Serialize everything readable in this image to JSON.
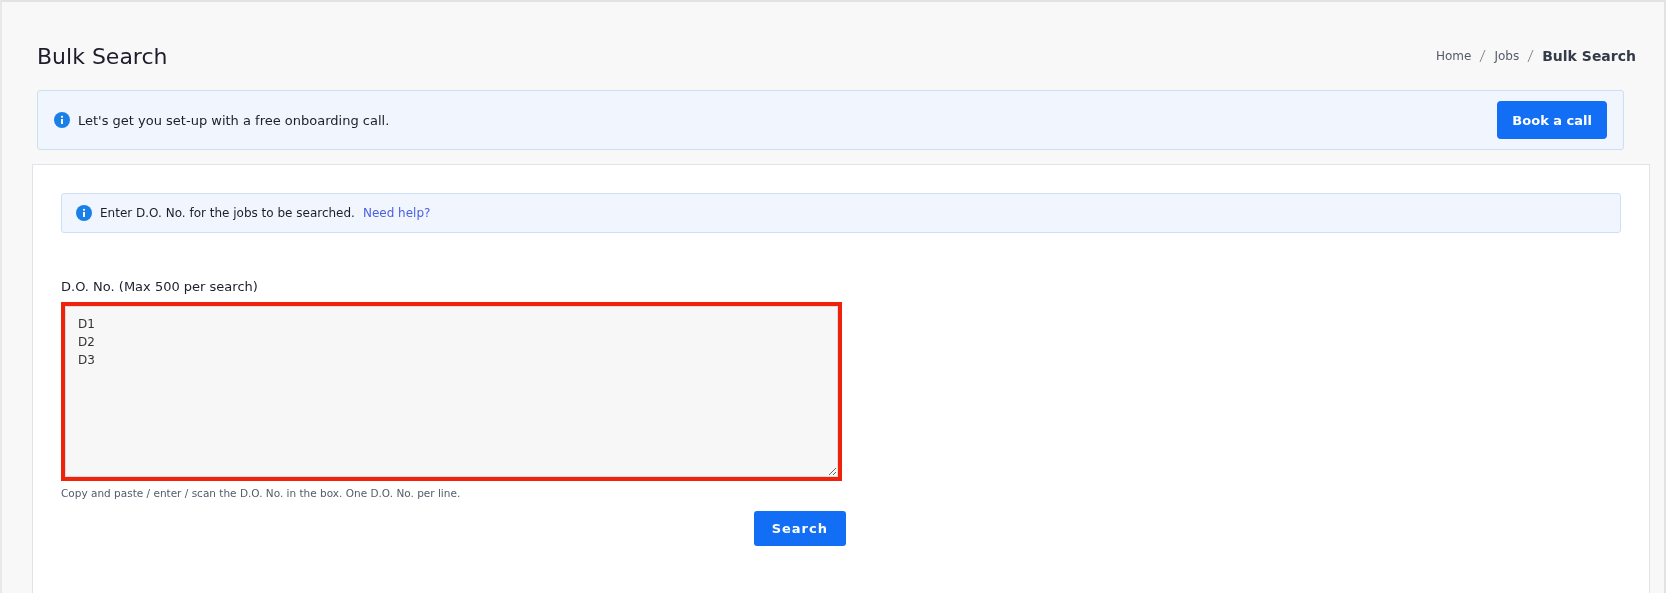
{
  "page_title": "Bulk Search",
  "breadcrumb": [
    {
      "label": "Home",
      "current": false
    },
    {
      "label": "Jobs",
      "current": false
    },
    {
      "label": "Bulk Search",
      "current": true
    }
  ],
  "banner": {
    "text": "Let's get you set-up with a free onboarding call.",
    "button": "Book a call"
  },
  "info": {
    "text": "Enter D.O. No. for the jobs to be searched.",
    "link": "Need help?"
  },
  "field": {
    "label": "D.O. No. (Max 500 per search)",
    "value": "D1\nD2\nD3",
    "highlighted": true,
    "hint": "Copy and paste / enter / scan the D.O. No. in the box. One D.O. No. per line."
  },
  "search_button": "Search"
}
